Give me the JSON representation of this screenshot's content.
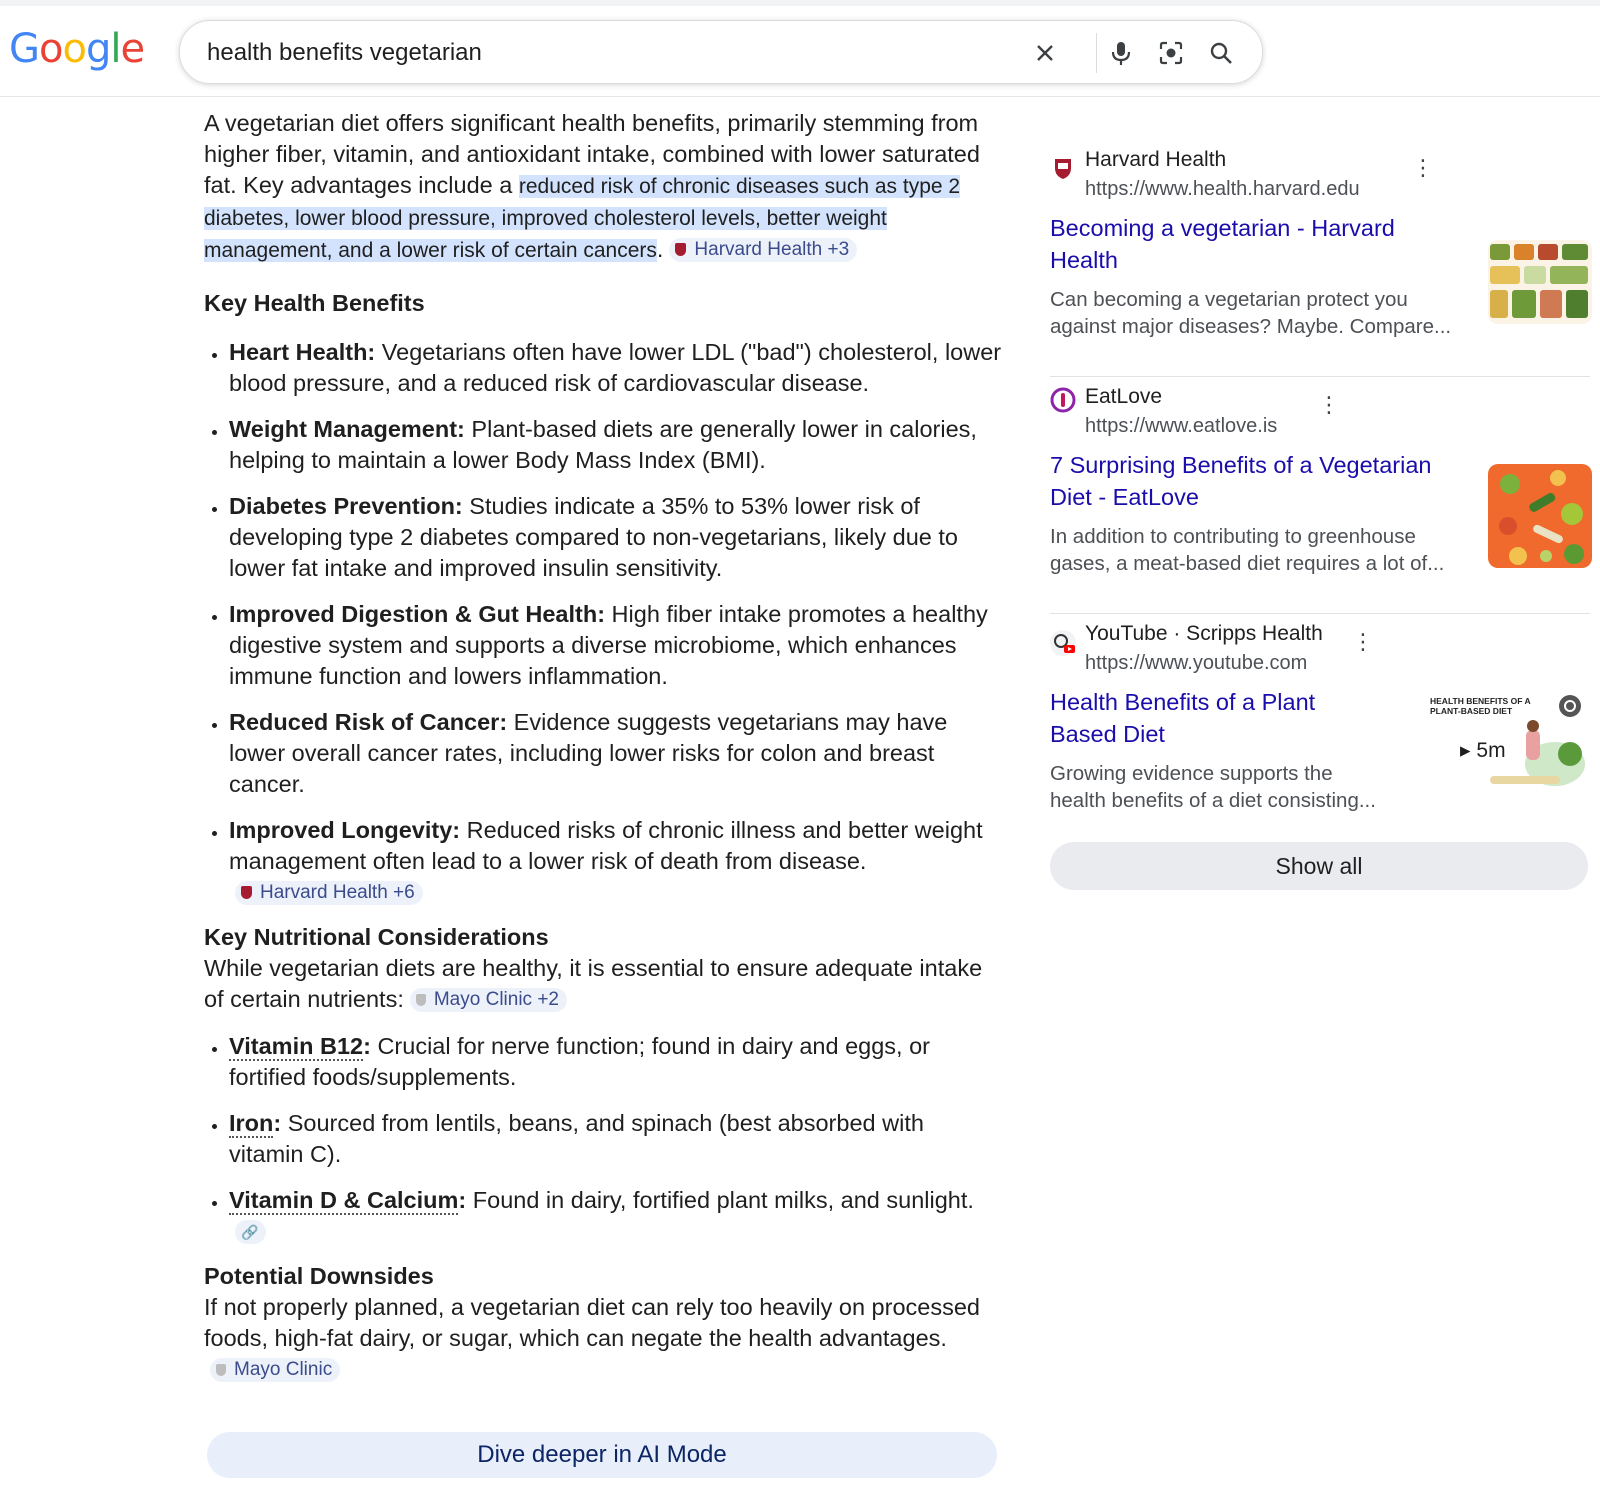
{
  "logo": {
    "letters": [
      "G",
      "o",
      "o",
      "g",
      "l",
      "e"
    ]
  },
  "search": {
    "query": "health benefits vegetarian"
  },
  "ai_overview": {
    "intro_text": "A vegetarian diet offers significant health benefits, primarily stemming from higher fiber, vitamin, and antioxidant intake, combined with lower saturated fat. Key advantages include a ",
    "intro_highlight": "reduced risk of chronic diseases such as type 2 diabetes, lower blood pressure, improved cholesterol levels, better weight management, and a lower risk of certain cancers",
    "intro_end": ".",
    "intro_chip": "Harvard Health +3",
    "section1_heading": "Key Health Benefits",
    "benefits": [
      {
        "term": "Heart Health:",
        "text": " Vegetarians often have lower LDL (\"bad\") cholesterol, lower blood pressure, and a reduced risk of cardiovascular disease."
      },
      {
        "term": "Weight Management:",
        "text": " Plant-based diets are generally lower in calories, helping to maintain a lower Body Mass Index (BMI)."
      },
      {
        "term": "Diabetes Prevention:",
        "text": " Studies indicate a 35% to 53% lower risk of developing type 2 diabetes compared to non-vegetarians, likely due to lower fat intake and improved insulin sensitivity."
      },
      {
        "term": "Improved Digestion & Gut Health:",
        "text": " High fiber intake promotes a healthy digestive system and supports a diverse microbiome, which enhances immune function and lowers inflammation."
      },
      {
        "term": "Reduced Risk of Cancer:",
        "text": " Evidence suggests vegetarians may have lower overall cancer rates, including lower risks for colon and breast cancer."
      },
      {
        "term": "Improved Longevity:",
        "text": " Reduced risks of chronic illness and better weight management often lead to a lower risk of death from disease."
      }
    ],
    "benefits_chip": "Harvard Health +6",
    "section2_heading": "Key Nutritional Considerations",
    "section2_intro": "While vegetarian diets are healthy, it is essential to ensure adequate intake of certain nutrients:",
    "section2_chip": "Mayo Clinic +2",
    "nutrients": [
      {
        "term": "Vitamin B12",
        "colon": ":",
        "text": " Crucial for nerve function; found in dairy and eggs, or fortified foods/supplements."
      },
      {
        "term": "Iron",
        "colon": ":",
        "text": " Sourced from lentils, beans, and spinach (best absorbed with vitamin C)."
      },
      {
        "term": "Vitamin D & Calcium",
        "colon": ":",
        "text": " Found in dairy, fortified plant milks, and sunlight."
      }
    ],
    "section3_heading": "Potential Downsides",
    "section3_text": "If not properly planned, a vegetarian diet can rely too heavily on processed foods, high-fat dairy, or sugar, which can negate the health advantages.",
    "section3_chip": "Mayo Clinic",
    "ai_mode_button": "Dive deeper in AI Mode"
  },
  "sources": [
    {
      "site": "Harvard Health",
      "url": "https://www.health.harvard.edu",
      "title": "Becoming a vegetarian - Harvard Health",
      "snippet1": "Can becoming a vegetarian protect you",
      "snippet2": "against major diseases? Maybe. Compare...",
      "favicon": "harvard-shield-icon"
    },
    {
      "site": "EatLove",
      "url": "https://www.eatlove.is",
      "title": "7 Surprising Benefits of a Vegetarian Diet - EatLove",
      "snippet1": "In addition to contributing to greenhouse",
      "snippet2": "gases, a meat-based diet requires a lot of...",
      "favicon": "eatlove-icon"
    },
    {
      "site": "YouTube · Scripps Health",
      "url": "https://www.youtube.com",
      "title": "Health Benefits of a Plant Based Diet",
      "snippet1": "Growing evidence supports the",
      "snippet2": "health benefits of a diet consisting...",
      "favicon": "youtube-icon",
      "thumb_caption": "HEALTH BENEFITS OF A PLANT-BASED DIET",
      "thumb_duration": "5m"
    }
  ],
  "show_all": "Show all",
  "colors": {
    "link": "#1a0dab",
    "highlight": "#d3e3fd",
    "chip_bg": "#edf2fa",
    "ai_mode_bg": "#e8effb"
  }
}
